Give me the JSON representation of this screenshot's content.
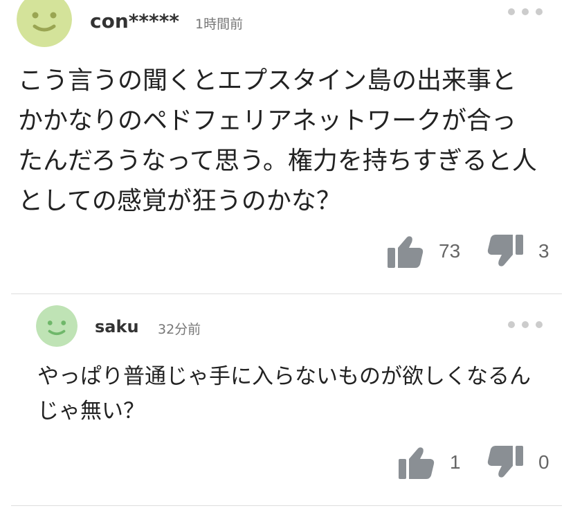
{
  "comments": [
    {
      "username": "con*****",
      "time": "1時間前",
      "body_lines": [
        "こう言うの聞くとエプスタイン島の出来事と",
        "かかなりのペドフェリアネットワークが合っ",
        "たんだろうなって思う。権力を持ちすぎると人",
        "としての感覚が狂うのかな？"
      ],
      "likes": "73",
      "dislikes": "3",
      "avatar_color": "#d4e39a",
      "avatar_face_color": "#9aa552"
    },
    {
      "username": "saku",
      "time": "32分前",
      "body_lines": [
        "やっぱり普通じゃ手に入らないものが欲しくなるん",
        "じゃ無い？"
      ],
      "likes": "1",
      "dislikes": "0",
      "avatar_color": "#bfe3b5",
      "avatar_face_color": "#6fb76a"
    }
  ],
  "icons": {
    "like": "thumbs-up-icon",
    "dislike": "thumbs-down-icon",
    "more": "more-options-icon"
  },
  "colors": {
    "icon_gray": "#8a8f94",
    "divider": "#dddddd"
  }
}
